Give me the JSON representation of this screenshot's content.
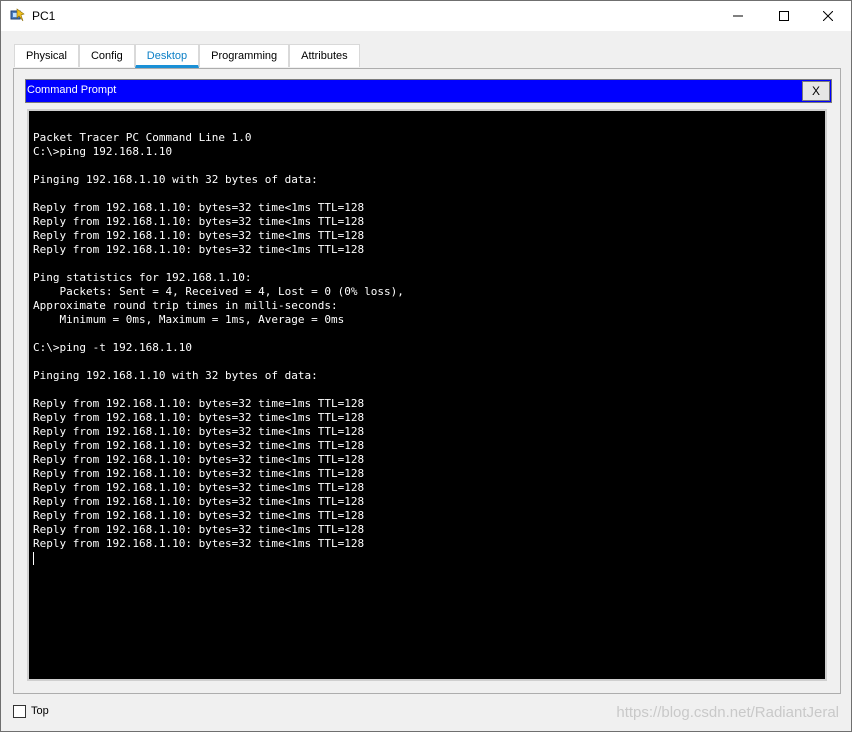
{
  "window": {
    "title": "PC1"
  },
  "tabs": [
    {
      "label": "Physical"
    },
    {
      "label": "Config"
    },
    {
      "label": "Desktop"
    },
    {
      "label": "Programming"
    },
    {
      "label": "Attributes"
    }
  ],
  "command_prompt": {
    "title": "Command Prompt",
    "close_label": "X",
    "lines": [
      "Packet Tracer PC Command Line 1.0",
      "C:\\>ping 192.168.1.10",
      "",
      "Pinging 192.168.1.10 with 32 bytes of data:",
      "",
      "Reply from 192.168.1.10: bytes=32 time<1ms TTL=128",
      "Reply from 192.168.1.10: bytes=32 time<1ms TTL=128",
      "Reply from 192.168.1.10: bytes=32 time<1ms TTL=128",
      "Reply from 192.168.1.10: bytes=32 time<1ms TTL=128",
      "",
      "Ping statistics for 192.168.1.10:",
      "    Packets: Sent = 4, Received = 4, Lost = 0 (0% loss),",
      "Approximate round trip times in milli-seconds:",
      "    Minimum = 0ms, Maximum = 1ms, Average = 0ms",
      "",
      "C:\\>ping -t 192.168.1.10",
      "",
      "Pinging 192.168.1.10 with 32 bytes of data:",
      "",
      "Reply from 192.168.1.10: bytes=32 time=1ms TTL=128",
      "Reply from 192.168.1.10: bytes=32 time<1ms TTL=128",
      "Reply from 192.168.1.10: bytes=32 time<1ms TTL=128",
      "Reply from 192.168.1.10: bytes=32 time<1ms TTL=128",
      "Reply from 192.168.1.10: bytes=32 time<1ms TTL=128",
      "Reply from 192.168.1.10: bytes=32 time<1ms TTL=128",
      "Reply from 192.168.1.10: bytes=32 time<1ms TTL=128",
      "Reply from 192.168.1.10: bytes=32 time<1ms TTL=128",
      "Reply from 192.168.1.10: bytes=32 time<1ms TTL=128",
      "Reply from 192.168.1.10: bytes=32 time<1ms TTL=128",
      "Reply from 192.168.1.10: bytes=32 time<1ms TTL=128"
    ]
  },
  "footer": {
    "top_label": "Top",
    "watermark": "https://blog.csdn.net/RadiantJeral"
  },
  "colors": {
    "accent": "#0b7fc6",
    "cmd_header": "#0000ff",
    "terminal_bg": "#000000"
  },
  "icons": [
    "packet-tracer-pc-icon",
    "minimize-icon",
    "maximize-icon",
    "close-icon"
  ]
}
